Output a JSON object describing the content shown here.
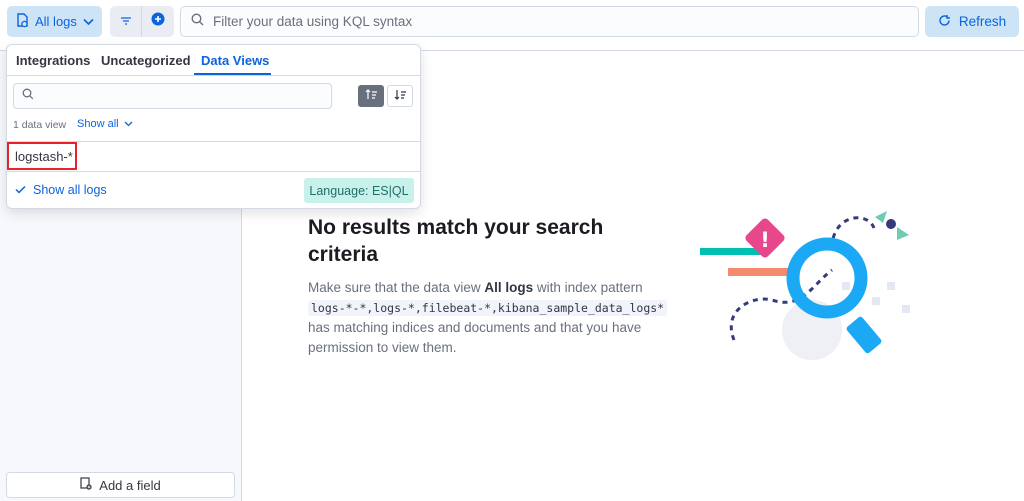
{
  "query_bar": {
    "data_view_label": "All logs",
    "search_placeholder": "Filter your data using KQL syntax",
    "refresh_label": "Refresh"
  },
  "popover": {
    "tabs": [
      "Integrations",
      "Uncategorized",
      "Data Views"
    ],
    "active_tab": "Data Views",
    "search_value": "",
    "count_label": "1 data view",
    "show_all_label": "Show all",
    "items": [
      "logstash-*"
    ],
    "show_all_logs_label": "Show all logs",
    "language_label": "Language: ES|QL"
  },
  "sidebar": {
    "add_field_label": "Add a field"
  },
  "empty_state": {
    "title": "No results match your search criteria",
    "body_pre": "Make sure that the data view ",
    "data_view_name": "All logs",
    "body_mid": " with index pattern ",
    "index_pattern": "logs-*-*,logs-*,filebeat-*,kibana_sample_data_logs*",
    "body_post": " has matching indices and documents and that you have permission to view them."
  },
  "colors": {
    "accent": "#0b64dd",
    "accent_bg": "#cce4f5",
    "highlight_border": "#e7222a",
    "language_badge_bg": "#c9f1ec"
  }
}
